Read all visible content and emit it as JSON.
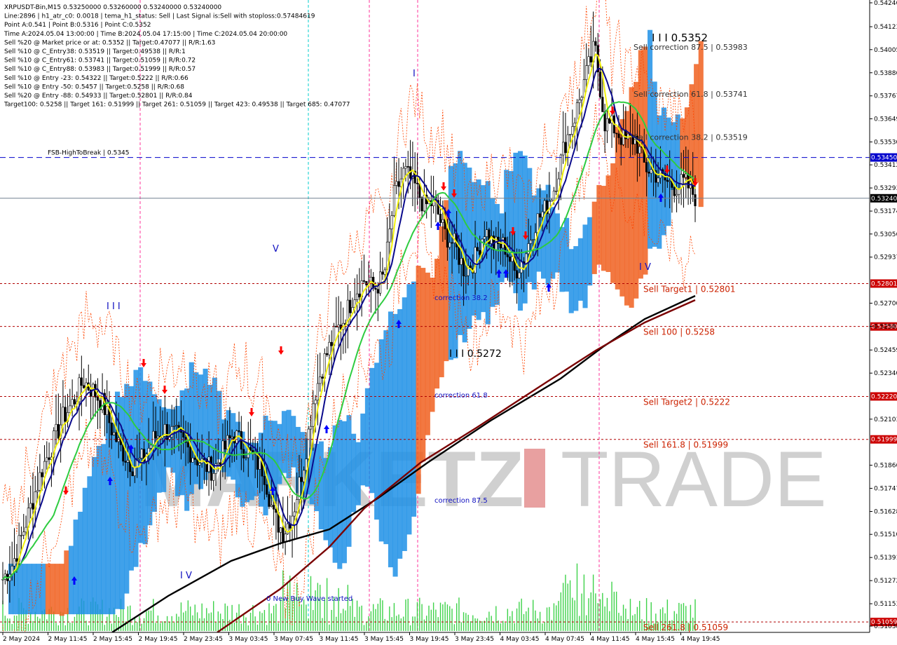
{
  "colors": {
    "background": "#ffffff",
    "bull_candle": "#000000",
    "bear_candle": "#000000",
    "cloud_blue": "#1e90e6",
    "cloud_orange": "#f06020",
    "ma_black": "#000000",
    "ma_darkred": "#7a0000",
    "ma_green": "#2ecc40",
    "ma_navy": "#0a0a8c",
    "ma_yellow": "#f2f20a",
    "envelope": "#ff4500",
    "volume": "#3ed24a",
    "level_line": "#b00000",
    "fsb_line": "#0000cc",
    "current_line": "#708090",
    "vline_pink": "#ff3399",
    "vline_cyan": "#00cccc",
    "watermark": "#d0d0d0",
    "watermark_accent": "#e8a0a0",
    "arrow_up": "#0000ff",
    "arrow_down": "#ff0000"
  },
  "info": [
    "XRPUSDT-Bin,M15  0.53250000 0.53260000 0.53240000 0.53240000",
    "Line:2896 | h1_atr_c0: 0.0018 | tema_h1_status: Sell | Last Signal is:Sell with stoploss:0.57484619",
    "Point A:0.541 | Point B:0.5316 | Point C:0.5352",
    "Time A:2024.05.04 13:00:00 | Time B:2024.05.04 17:15:00 | Time C:2024.05.04 20:00:00",
    "Sell %20 @ Market price or at: 0.5352 || Target:0.47077 || R/R:1.63",
    "Sell %10 @ C_Entry38: 0.53519 || Target:0.49538 || R/R:1",
    "Sell %10 @ C_Entry61: 0.53741 || Target:0.51059 || R/R:0.72",
    "Sell %10 @ C_Entry88: 0.53983 || Target:0.51999 || R/R:0.57",
    "Sell %10 @ Entry -23: 0.54322 || Target:0.5222 || R/R:0.66",
    "Sell %10 @ Entry -50: 0.5457 || Target:0.5258 || R/R:0.68",
    "Sell %20 @ Entry -88: 0.54933 || Target:0.52801 || R/R:0.84",
    "Target100: 0.5258 || Target 161: 0.51999 || Target 261: 0.51059 || Target 423: 0.49538 || Target 685: 0.47077"
  ],
  "watermark": {
    "part1": "MARKETZ",
    "part2": "I",
    "part3": "TRADE"
  },
  "chart_data": {
    "type": "candlestick",
    "symbol": "XRPUSDT-Bin",
    "timeframe": "M15",
    "ylim": [
      0.51038,
      0.54246
    ],
    "y_ticks": [
      "0.54246",
      "0.54123",
      "0.54005",
      "0.53886",
      "0.53767",
      "0.53649",
      "0.53530",
      "0.53412",
      "0.53293",
      "0.53174",
      "0.53056",
      "0.52937",
      "0.52700",
      "0.52581",
      "0.52459",
      "0.52340",
      "0.52103",
      "0.51866",
      "0.51747",
      "0.51628",
      "0.51510",
      "0.51391",
      "0.51272",
      "0.51153",
      "0.51038"
    ],
    "x_ticks": [
      "2 May 2024",
      "2 May 11:45",
      "2 May 15:45",
      "2 May 19:45",
      "2 May 23:45",
      "3 May 03:45",
      "3 May 07:45",
      "3 May 11:45",
      "3 May 15:45",
      "3 May 19:45",
      "3 May 23:45",
      "4 May 03:45",
      "4 May 07:45",
      "4 May 11:45",
      "4 May 15:45",
      "4 May 19:45"
    ],
    "price_path": [
      0.5128,
      0.5136,
      0.5152,
      0.5169,
      0.5186,
      0.5198,
      0.5211,
      0.5219,
      0.523,
      0.5225,
      0.5218,
      0.5203,
      0.5193,
      0.5186,
      0.519,
      0.52,
      0.5205,
      0.5203,
      0.5198,
      0.5192,
      0.5187,
      0.5184,
      0.5194,
      0.5203,
      0.5196,
      0.519,
      0.5184,
      0.516,
      0.5152,
      0.5164,
      0.5188,
      0.5222,
      0.524,
      0.5253,
      0.5262,
      0.5275,
      0.5282,
      0.5277,
      0.5284,
      0.5325,
      0.5338,
      0.5331,
      0.532,
      0.5322,
      0.5306,
      0.53,
      0.5287,
      0.5292,
      0.5308,
      0.5299,
      0.53,
      0.5286,
      0.5294,
      0.5311,
      0.5318,
      0.533,
      0.5352,
      0.5366,
      0.5385,
      0.5402,
      0.5363,
      0.536,
      0.5353,
      0.5355,
      0.534,
      0.5337,
      0.5333,
      0.533,
      0.5332,
      0.5325
    ],
    "current_price": "0.53240",
    "levels": [
      {
        "label": "Sell Target1 | 0.52801",
        "value": 0.52801,
        "tag": "0.52801"
      },
      {
        "label": "Sell 100 | 0.5258",
        "value": 0.5258,
        "tag": "0.52580"
      },
      {
        "label": "Sell Target2 | 0.5222",
        "value": 0.5222,
        "tag": "0.52220"
      },
      {
        "label": "Sell 161.8 | 0.51999",
        "value": 0.51999,
        "tag": "0.51999"
      },
      {
        "label": "Sell 261.8 | 0.51059",
        "value": 0.51059,
        "tag": "0.51059"
      }
    ],
    "fsb": {
      "label": "FSB-HighToBreak | 0.5345",
      "value": 0.5345,
      "tag": "0.53450"
    },
    "correction_labels": [
      {
        "text": "Sell correction 87.5 | 0.53983",
        "value": 0.53983
      },
      {
        "text": "Sell correction 61.8 | 0.53741",
        "value": 0.53741
      },
      {
        "text": "Sell correction 38.2 | 0.53519",
        "value": 0.53519
      }
    ],
    "blue_labels": [
      "correction 38.2",
      "correction 61.8",
      "correction 87.5",
      "0 New Buy Wave started"
    ],
    "wave_labels": [
      "I I I 0.5352",
      "I I I 0.5272",
      "I",
      "V",
      "I I I",
      "I V",
      "I V"
    ]
  }
}
